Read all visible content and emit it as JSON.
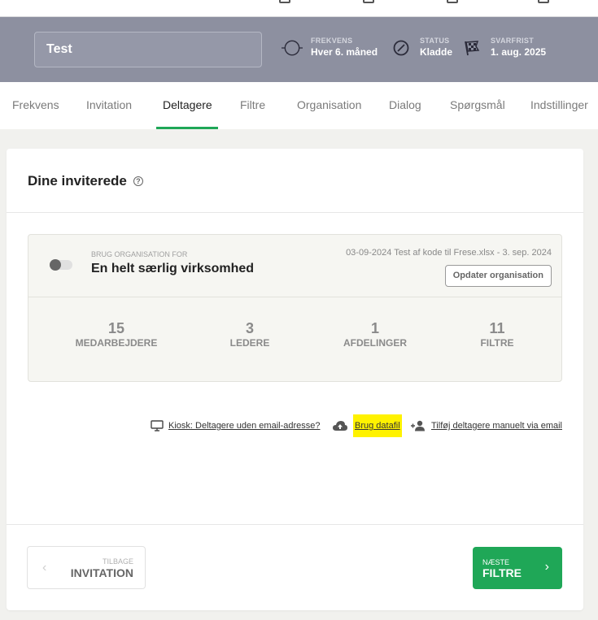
{
  "survey": {
    "name": "Test",
    "frequency": {
      "label": "FREKVENS",
      "value": "Hver 6. måned"
    },
    "status": {
      "label": "STATUS",
      "value": "Kladde"
    },
    "deadline": {
      "label": "SVARFRIST",
      "value": "1. aug. 2025"
    }
  },
  "tabs": [
    {
      "label": "Frekvens"
    },
    {
      "label": "Invitation"
    },
    {
      "label": "Deltagere"
    },
    {
      "label": "Filtre"
    },
    {
      "label": "Organisation"
    },
    {
      "label": "Dialog"
    },
    {
      "label": "Spørgsmål"
    },
    {
      "label": "Indstillinger"
    }
  ],
  "card": {
    "title": "Dine inviterede",
    "help_glyph": "?"
  },
  "organisation": {
    "use_label": "BRUG ORGANISATION FOR",
    "name": "En helt særlig virksomhed",
    "file_info": "03-09-2024 Test af kode til Frese.xlsx - 3. sep. 2024",
    "update_button": "Opdater organisation",
    "stats": [
      {
        "value": "15",
        "label": "MEDARBEJDERE"
      },
      {
        "value": "3",
        "label": "LEDERE"
      },
      {
        "value": "1",
        "label": "AFDELINGER"
      },
      {
        "value": "11",
        "label": "FILTRE"
      }
    ]
  },
  "links": {
    "kiosk": "Kiosk: Deltagere uden email-adresse?",
    "datafile": "Brug datafil",
    "manual": "Tilføj deltagere manuelt via email"
  },
  "nav": {
    "back_small": "TILBAGE",
    "back_label": "INVITATION",
    "next_small": "NÆSTE",
    "next_label": "FILTRE"
  },
  "colors": {
    "accent": "#1fa757",
    "header_bg": "#8d90a0",
    "highlight": "#fff200"
  }
}
